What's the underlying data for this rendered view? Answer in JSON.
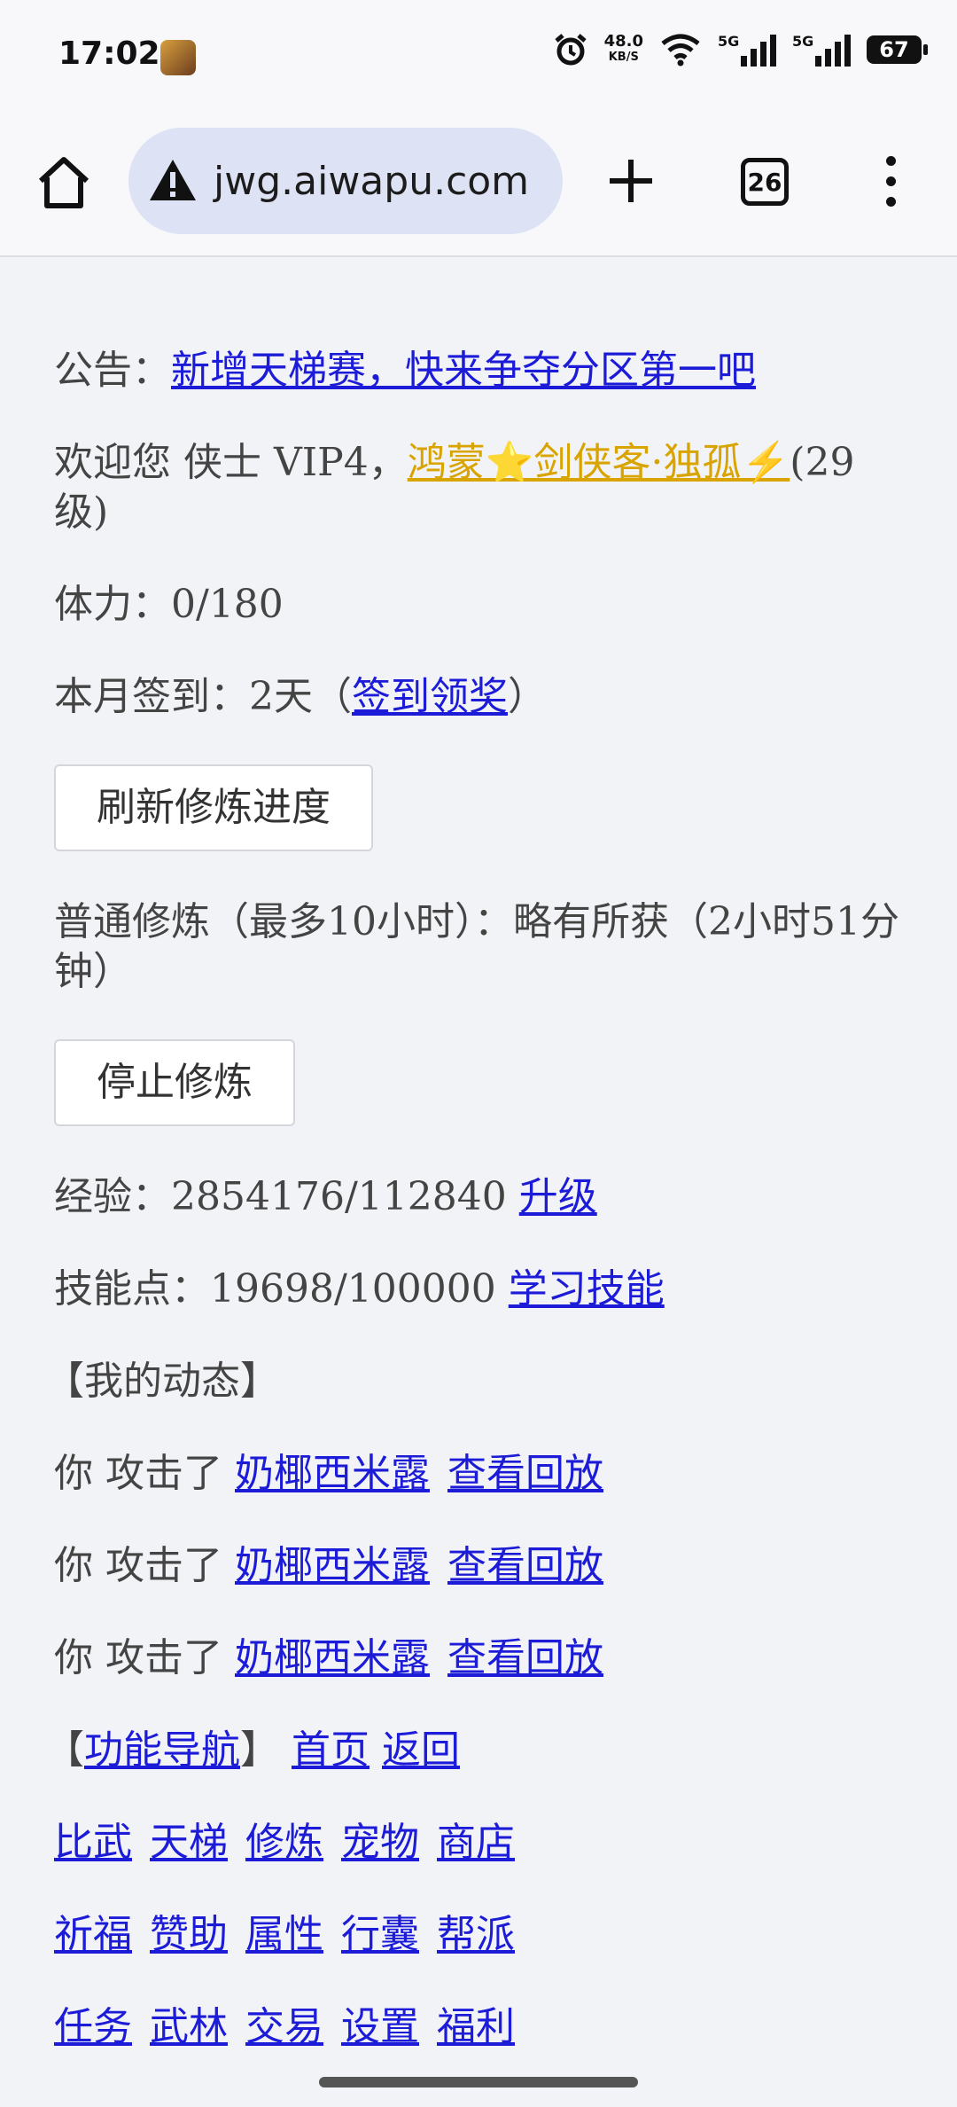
{
  "status_bar": {
    "time": "17:02",
    "net_speed_value": "48.0",
    "net_speed_unit": "KB/S",
    "signal1_label": "5G",
    "signal2_label": "5G",
    "battery": "67"
  },
  "browser": {
    "url": "jwg.aiwapu.com",
    "tab_count": "26"
  },
  "page": {
    "notice_label": "公告：",
    "notice_link": "新增天梯赛，快来争夺分区第一吧",
    "welcome_prefix": "欢迎您 侠士 VIP4，",
    "player_name": "鸿蒙⭐剑侠客·独孤⚡",
    "player_level": "(29级)",
    "stamina": "体力：0/180",
    "checkin_text": "本月签到：2天（",
    "checkin_link": "签到领奖",
    "checkin_close": "）",
    "refresh_button": "刷新修炼进度",
    "cultivation_status": "普通修炼（最多10小时）：略有所获（2小时51分钟）",
    "stop_button": "停止修炼",
    "exp_text": "经验：2854176/112840",
    "levelup_link": "升级",
    "skill_text": "技能点：19698/100000",
    "learn_skill_link": "学习技能",
    "dynamics_header": "【我的动态】",
    "dynamics": [
      {
        "text": "你 攻击了",
        "target": "奶椰西米露",
        "replay": "查看回放"
      },
      {
        "text": "你 攻击了",
        "target": "奶椰西米露",
        "replay": "查看回放"
      },
      {
        "text": "你 攻击了",
        "target": "奶椰西米露",
        "replay": "查看回放"
      }
    ],
    "nav_bracket_open": "【",
    "nav_title": "功能导航",
    "nav_bracket_close": "】",
    "nav_home": "首页",
    "nav_back": "返回",
    "nav_row1": [
      "比武",
      "天梯",
      "修炼",
      "宠物",
      "商店"
    ],
    "nav_row2": [
      "祈福",
      "赞助",
      "属性",
      "行囊",
      "帮派"
    ],
    "nav_row3": [
      "任务",
      "武林",
      "交易",
      "设置",
      "福利"
    ]
  }
}
